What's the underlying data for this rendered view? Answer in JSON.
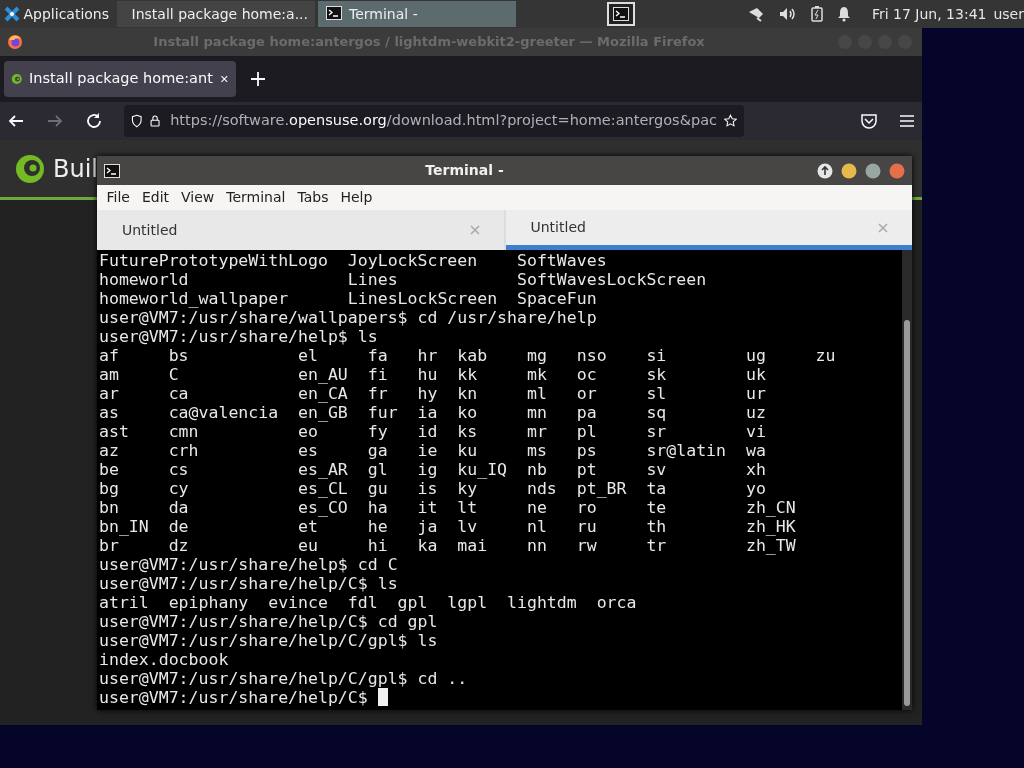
{
  "panel": {
    "menu_label": "Applications",
    "tasks": [
      {
        "kind": "browser",
        "label": "Install package home:a...",
        "selected": false
      },
      {
        "kind": "terminal",
        "label": "Terminal -",
        "selected": true
      }
    ],
    "clock": "Fri 17 Jun, 13:41",
    "user": "user"
  },
  "browser": {
    "title": "Install package home:antergos / lightdm-webkit2-greeter — Mozilla Firefox",
    "tab": {
      "label": "Install package home:ant",
      "selected": true
    },
    "url": {
      "prefix": "https://software.",
      "domain": "opensuse.org",
      "suffix": "/download.html?project=home:antergos&pac"
    },
    "forward_disabled": true,
    "page": {
      "heading": "Buil"
    }
  },
  "terminal": {
    "title": "Terminal -",
    "menu": [
      "File",
      "Edit",
      "View",
      "Terminal",
      "Tabs",
      "Help"
    ],
    "tabs": [
      {
        "label": "Untitled",
        "selected": false
      },
      {
        "label": "Untitled",
        "selected": true
      }
    ],
    "cursor_visible": true,
    "lines": [
      {
        "kind": "columns",
        "rows": [
          [
            "FuturePrototypeWithLogo",
            "JoyLockScreen",
            "SoftWaves"
          ],
          [
            "homeworld",
            "Lines",
            "SoftWavesLockScreen"
          ],
          [
            "homeworld_wallpaper",
            "LinesLockScreen",
            "SpaceFun"
          ]
        ]
      },
      {
        "kind": "prompt",
        "prompt": "user@VM7:/usr/share/wallpapers$",
        "command": "cd /usr/share/help"
      },
      {
        "kind": "prompt",
        "prompt": "user@VM7:/usr/share/help$",
        "command": "ls"
      },
      {
        "kind": "columns",
        "rows": [
          [
            "af",
            "bs",
            "el",
            "fa",
            "hr",
            "kab",
            "mg",
            "nso",
            "si",
            "ug",
            "zu"
          ],
          [
            "am",
            "C",
            "en_AU",
            "fi",
            "hu",
            "kk",
            "mk",
            "oc",
            "sk",
            "uk"
          ],
          [
            "ar",
            "ca",
            "en_CA",
            "fr",
            "hy",
            "kn",
            "ml",
            "or",
            "sl",
            "ur"
          ],
          [
            "as",
            "ca@valencia",
            "en_GB",
            "fur",
            "ia",
            "ko",
            "mn",
            "pa",
            "sq",
            "uz"
          ],
          [
            "ast",
            "cmn",
            "eo",
            "fy",
            "id",
            "ks",
            "mr",
            "pl",
            "sr",
            "vi"
          ],
          [
            "az",
            "crh",
            "es",
            "ga",
            "ie",
            "ku",
            "ms",
            "ps",
            "sr@latin",
            "wa"
          ],
          [
            "be",
            "cs",
            "es_AR",
            "gl",
            "ig",
            "ku_IQ",
            "nb",
            "pt",
            "sv",
            "xh"
          ],
          [
            "bg",
            "cy",
            "es_CL",
            "gu",
            "is",
            "ky",
            "nds",
            "pt_BR",
            "ta",
            "yo"
          ],
          [
            "bn",
            "da",
            "es_CO",
            "ha",
            "it",
            "lt",
            "ne",
            "ro",
            "te",
            "zh_CN"
          ],
          [
            "bn_IN",
            "de",
            "et",
            "he",
            "ja",
            "lv",
            "nl",
            "ru",
            "th",
            "zh_HK"
          ],
          [
            "br",
            "dz",
            "eu",
            "hi",
            "ka",
            "mai",
            "nn",
            "rw",
            "tr",
            "zh_TW"
          ]
        ]
      },
      {
        "kind": "prompt",
        "prompt": "user@VM7:/usr/share/help$",
        "command": "cd C"
      },
      {
        "kind": "prompt",
        "prompt": "user@VM7:/usr/share/help/C$",
        "command": "ls"
      },
      {
        "kind": "columns",
        "rows": [
          [
            "atril",
            "epiphany",
            "evince",
            "fdl",
            "gpl",
            "lgpl",
            "lightdm",
            "orca"
          ]
        ]
      },
      {
        "kind": "prompt",
        "prompt": "user@VM7:/usr/share/help/C$",
        "command": "cd gpl"
      },
      {
        "kind": "prompt",
        "prompt": "user@VM7:/usr/share/help/C/gpl$",
        "command": "ls"
      },
      {
        "kind": "output",
        "text": "index.docbook"
      },
      {
        "kind": "prompt",
        "prompt": "user@VM7:/usr/share/help/C/gpl$",
        "command": "cd .."
      },
      {
        "kind": "prompt",
        "prompt": "user@VM7:/usr/share/help/C$"
      }
    ]
  }
}
